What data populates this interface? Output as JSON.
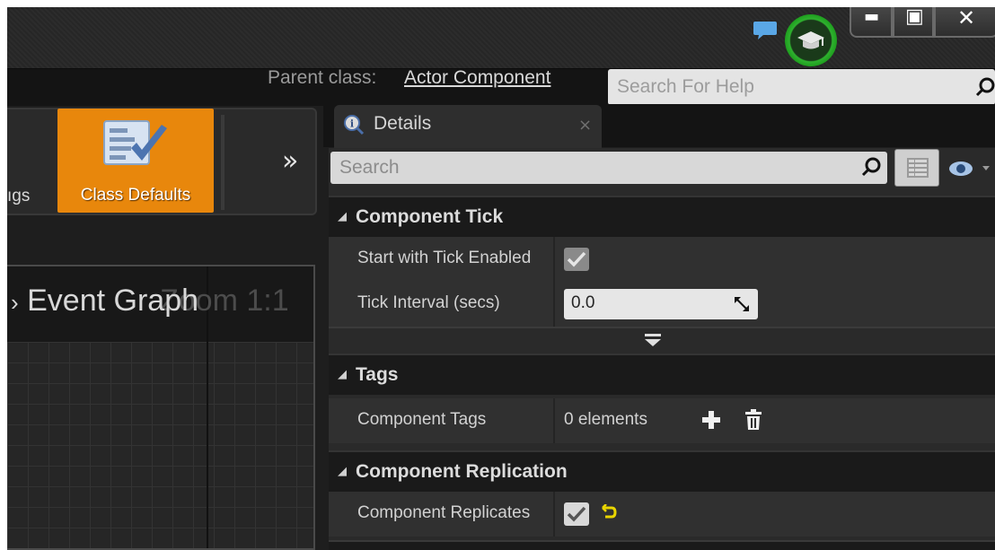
{
  "window": {
    "minimize_glyph": "▬",
    "maximize_glyph": "▣",
    "close_glyph": "✕"
  },
  "header": {
    "parent_class_label": "Parent class:",
    "parent_class_value": "Actor Component",
    "help_search_placeholder": "Search For Help"
  },
  "toolbar": {
    "partial_label": "ıgs",
    "class_defaults_label": "Class Defaults",
    "more_glyph": "»"
  },
  "graph": {
    "title_prefix": "›",
    "title": "Event Graph",
    "zoom": "Zoom 1:1"
  },
  "details": {
    "tab_label": "Details",
    "tab_close": "×",
    "search_placeholder": "Search",
    "sections": {
      "component_tick": {
        "title": "Component Tick",
        "start_with_tick_label": "Start with Tick Enabled",
        "start_with_tick_checked": true,
        "tick_interval_label": "Tick Interval (secs)",
        "tick_interval_value": "0.0"
      },
      "tags": {
        "title": "Tags",
        "component_tags_label": "Component Tags",
        "component_tags_value": "0 elements"
      },
      "replication": {
        "title": "Component Replication",
        "component_replicates_label": "Component Replicates",
        "component_replicates_checked": true
      }
    }
  },
  "colors": {
    "accent_orange": "#e8870c",
    "learn_green": "#2fb12f",
    "reset_yellow": "#e8d400"
  }
}
